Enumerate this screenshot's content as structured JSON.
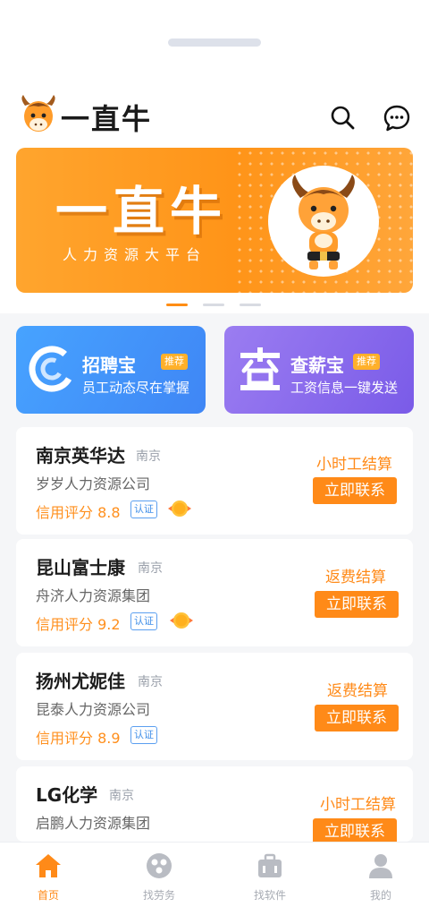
{
  "app": {
    "title": "一直牛"
  },
  "banner": {
    "title": "一直牛",
    "subtitle": "人力资源大平台",
    "slide_count": 3,
    "active_slide": 1
  },
  "promos": [
    {
      "title": "招聘宝",
      "tag": "推荐",
      "desc": "员工动态尽在掌握",
      "color": "#4a97fb",
      "icon": "c-logo-icon"
    },
    {
      "title": "查薪宝",
      "tag": "推荐",
      "desc": "工资信息一键发送",
      "color": "#8a6cee",
      "icon": "cha-icon"
    }
  ],
  "listings": [
    {
      "company": "南京英华达",
      "city": "南京",
      "agency": "岁岁人力资源公司",
      "rating": "信用评分 8.8",
      "verified": "认证",
      "vip": true,
      "pay_type": "小时工结算",
      "action": "立即联系"
    },
    {
      "company": "昆山富士康",
      "city": "南京",
      "agency": "舟济人力资源集团",
      "rating": "信用评分 9.2",
      "verified": "认证",
      "vip": true,
      "pay_type": "返费结算",
      "action": "立即联系"
    },
    {
      "company": "扬州尤妮佳",
      "city": "南京",
      "agency": "昆泰人力资源公司",
      "rating": "信用评分 8.9",
      "verified": "认证",
      "vip": false,
      "pay_type": "返费结算",
      "action": "立即联系"
    },
    {
      "company": "LG化学",
      "city": "南京",
      "agency": "启鹏人力资源集团",
      "rating": "",
      "verified": "",
      "vip": false,
      "pay_type": "小时工结算",
      "action": "立即联系"
    }
  ],
  "tabs": [
    {
      "label": "首页",
      "icon": "home-icon",
      "active": true
    },
    {
      "label": "找劳务",
      "icon": "labor-icon",
      "active": false
    },
    {
      "label": "找软件",
      "icon": "briefcase-icon",
      "active": false
    },
    {
      "label": "我的",
      "icon": "user-icon",
      "active": false
    }
  ],
  "colors": {
    "accent": "#ff8a18",
    "blue": "#4a97fb",
    "purple": "#8a6cee",
    "tab_inactive": "#a7abb3"
  }
}
